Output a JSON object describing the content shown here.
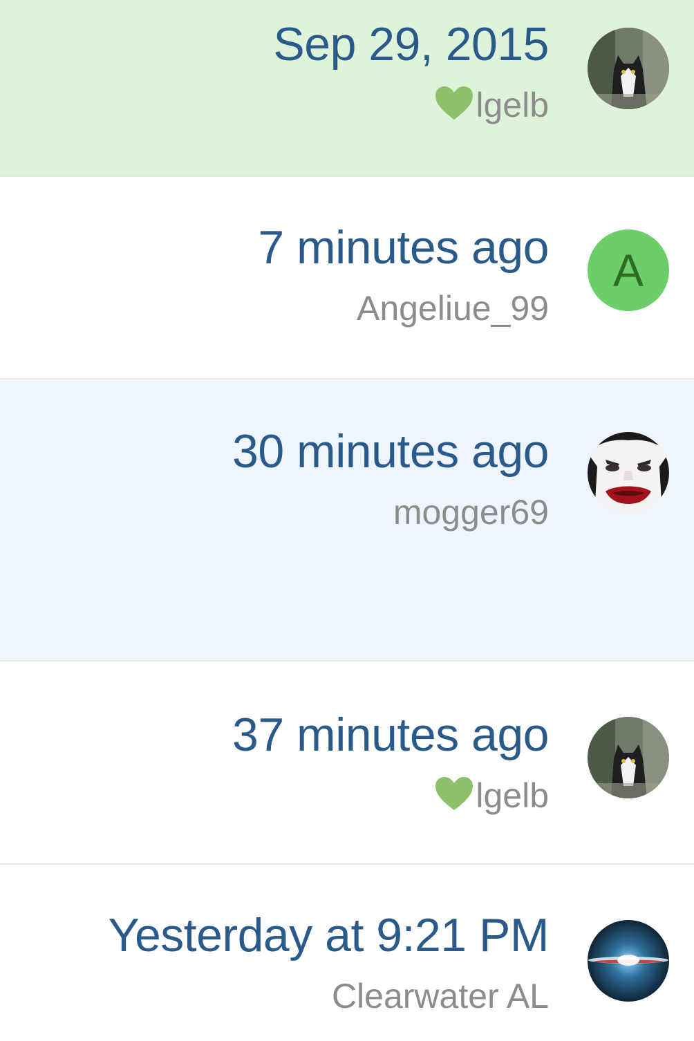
{
  "items": [
    {
      "time": "Sep 29, 2015",
      "user": "lgelb",
      "liked": true,
      "avatar_icon": "cat-photo-avatar",
      "background": "#def3d9"
    },
    {
      "time": "7 minutes ago",
      "user": "Angeliue_99",
      "liked": false,
      "avatar_letter": "A",
      "avatar_color": "#6cce6a",
      "background": "#ffffff"
    },
    {
      "time": "30 minutes ago",
      "user": "mogger69",
      "liked": false,
      "avatar_icon": "face-paint-avatar",
      "background": "#eef5fd"
    },
    {
      "time": "37 minutes ago",
      "user": "lgelb",
      "liked": true,
      "avatar_icon": "cat-photo-avatar",
      "background": "#ffffff"
    },
    {
      "time": "Yesterday at 9:21 PM",
      "user": "Clearwater AL",
      "liked": false,
      "avatar_icon": "galaxy-avatar",
      "background": "#ffffff"
    }
  ],
  "colors": {
    "time_text": "#2a5a8a",
    "user_text": "#8c8c8c",
    "heart": "#8cc06a",
    "divider": "#e6e6e6"
  }
}
